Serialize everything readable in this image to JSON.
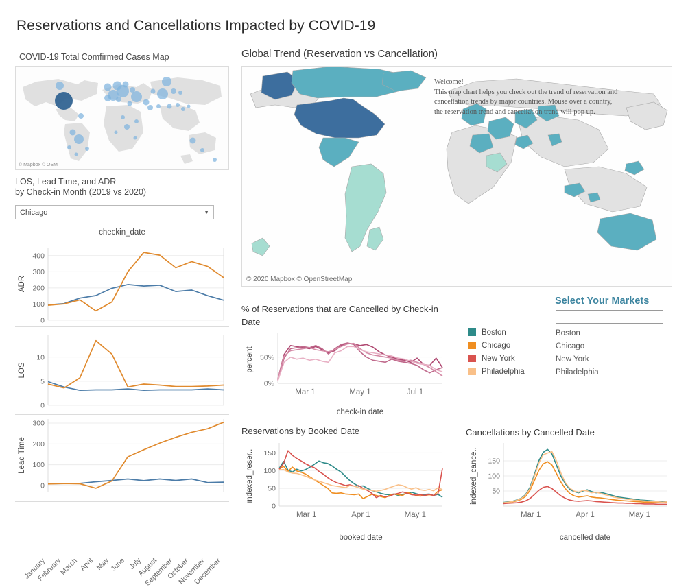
{
  "dashboard": {
    "title": "Reservations and Cancellations Impacted by COVID-19"
  },
  "covid_map": {
    "title": "COVID-19 Total Comfirmed Cases Map",
    "attribution": "© Mapbox © OSM"
  },
  "los_panel": {
    "title_line1": "LOS, Lead Time, and ADR",
    "title_line2": "by Check-in Month (2019 vs 2020)",
    "selected_market": "Chicago",
    "caret_icon": "▼",
    "column_label": "checkin_date"
  },
  "global_map": {
    "title": "Global Trend (Reservation vs Cancellation)",
    "attribution": "© 2020 Mapbox  © OpenStreetMap",
    "welcome": {
      "heading": "Welcome!",
      "body": "This map chart helps you check out the trend of reservation and cancellation trends by major countries. Mouse over a country, the reservation trend and cancellation trend will pop up."
    },
    "colors": {
      "high": "#3d6e9e",
      "mid": "#5bafc0",
      "low": "#a6ddd1",
      "none": "#e2e2e2",
      "border": "#a0a0a0"
    }
  },
  "legend": {
    "items": [
      {
        "label": "Boston",
        "color": "#2e8b89"
      },
      {
        "label": "Chicago",
        "color": "#ef8e21"
      },
      {
        "label": "New York",
        "color": "#d9534f"
      },
      {
        "label": "Philadelphia",
        "color": "#f9c089"
      }
    ]
  },
  "markets_filter": {
    "title": "Select Your Markets",
    "search_value": "",
    "search_placeholder": "",
    "options": [
      "Boston",
      "Chicago",
      "New York",
      "Philadelphia"
    ]
  },
  "chart_data": [
    {
      "type": "line",
      "name": "adr-by-checkin-month",
      "title": "checkin_date",
      "ylabel": "ADR",
      "xlabel": "",
      "ylim": [
        0,
        450
      ],
      "yticks": [
        0,
        100,
        200,
        300,
        400
      ],
      "grid": true,
      "categories": [
        "January",
        "February",
        "March",
        "April",
        "May",
        "June",
        "July",
        "August",
        "September",
        "October",
        "November",
        "December"
      ],
      "series": [
        {
          "name": "2019",
          "color": "#4c7ca8",
          "values": [
            95,
            103,
            137,
            153,
            198,
            221,
            212,
            217,
            178,
            187,
            152,
            124
          ]
        },
        {
          "name": "2020",
          "color": "#e08a2e",
          "values": [
            93,
            101,
            126,
            58,
            113,
            300,
            420,
            403,
            325,
            363,
            333,
            264
          ]
        }
      ]
    },
    {
      "type": "line",
      "name": "los-by-checkin-month",
      "title": "",
      "ylabel": "LOS",
      "xlabel": "",
      "ylim": [
        0,
        14.5
      ],
      "yticks": [
        0,
        5,
        10
      ],
      "grid": true,
      "categories": [
        "January",
        "February",
        "March",
        "April",
        "May",
        "June",
        "July",
        "August",
        "September",
        "October",
        "November",
        "December"
      ],
      "series": [
        {
          "name": "2019",
          "color": "#4c7ca8",
          "values": [
            4.9,
            3.8,
            3.1,
            3.2,
            3.2,
            3.4,
            3.1,
            3.2,
            3.2,
            3.2,
            3.4,
            3.2
          ]
        },
        {
          "name": "2020",
          "color": "#e08a2e",
          "values": [
            4.4,
            3.6,
            5.7,
            13.4,
            10.6,
            3.8,
            4.4,
            4.2,
            3.9,
            3.9,
            4.0,
            4.2
          ]
        }
      ]
    },
    {
      "type": "line",
      "name": "lead-time-by-checkin-month",
      "title": "",
      "ylabel": "Lead Time",
      "xlabel": "",
      "ylim": [
        -30,
        320
      ],
      "yticks": [
        0,
        100,
        200,
        300
      ],
      "grid": true,
      "categories": [
        "January",
        "February",
        "March",
        "April",
        "May",
        "June",
        "July",
        "August",
        "September",
        "October",
        "November",
        "December"
      ],
      "series": [
        {
          "name": "2019",
          "color": "#4c7ca8",
          "values": [
            8,
            9,
            10,
            18,
            24,
            31,
            23,
            31,
            24,
            31,
            14,
            16
          ]
        },
        {
          "name": "2020",
          "color": "#e08a2e",
          "values": [
            7,
            9,
            8,
            -13,
            22,
            138,
            172,
            204,
            232,
            256,
            273,
            304
          ]
        }
      ]
    },
    {
      "type": "line",
      "name": "pct-reservations-cancelled",
      "title": "% of Reservations that are Cancelled by Check-in Date",
      "ylabel": "percent",
      "xlabel": "check-in date",
      "ylim": [
        0,
        90
      ],
      "yticks": [
        0,
        50
      ],
      "ytick_labels": [
        "0%",
        "50%"
      ],
      "xticks": [
        "Mar 1",
        "May 1",
        "Jul 1"
      ],
      "grid": true,
      "series": [
        {
          "name": "Boston",
          "color": "#b04a72",
          "values": [
            8,
            55,
            72,
            70,
            68,
            66,
            70,
            64,
            58,
            62,
            72,
            76,
            75,
            72,
            74,
            69,
            60,
            54,
            50,
            46,
            44,
            40,
            48,
            36,
            34,
            48,
            30
          ]
        },
        {
          "name": "Chicago",
          "color": "#c06a8c",
          "values": [
            6,
            48,
            66,
            68,
            70,
            68,
            72,
            66,
            56,
            66,
            74,
            77,
            74,
            60,
            50,
            44,
            42,
            40,
            46,
            42,
            40,
            38,
            34,
            26,
            20,
            26,
            30
          ]
        },
        {
          "name": "New York",
          "color": "#d48aa6",
          "values": [
            7,
            52,
            62,
            64,
            66,
            68,
            64,
            62,
            60,
            64,
            70,
            75,
            76,
            66,
            58,
            54,
            52,
            50,
            48,
            44,
            42,
            44,
            40,
            36,
            30,
            22,
            14
          ]
        },
        {
          "name": "Philadelphia",
          "color": "#e8b0c4",
          "values": [
            5,
            40,
            50,
            46,
            48,
            44,
            46,
            42,
            40,
            58,
            62,
            70,
            70,
            64,
            60,
            58,
            56,
            54,
            52,
            48,
            46,
            42,
            38,
            36,
            34,
            26,
            22
          ]
        }
      ]
    },
    {
      "type": "line",
      "name": "reservations-by-booked-date",
      "title": "Reservations by Booked Date",
      "ylabel": "indexed_reser..",
      "xlabel": "booked date",
      "ylim": [
        0,
        170
      ],
      "yticks": [
        0,
        50,
        100,
        150
      ],
      "xticks": [
        "Mar 1",
        "Apr 1",
        "May 1"
      ],
      "grid": true,
      "series": [
        {
          "name": "Boston",
          "color": "#2e8b89",
          "values": [
            106,
            126,
            101,
            96,
            104,
            99,
            103,
            110,
            118,
            127,
            122,
            120,
            113,
            104,
            96,
            84,
            72,
            63,
            56,
            57,
            50,
            44,
            40,
            36,
            33,
            32,
            34,
            30,
            33,
            36,
            39,
            35,
            32,
            33,
            34,
            30,
            33,
            25
          ]
        },
        {
          "name": "Chicago",
          "color": "#ef8e21",
          "values": [
            104,
            112,
            98,
            110,
            99,
            95,
            90,
            82,
            74,
            66,
            58,
            50,
            37,
            36,
            37,
            34,
            33,
            32,
            34,
            21,
            27,
            33,
            30,
            27,
            24,
            30,
            34,
            32,
            30,
            39,
            34,
            30,
            28,
            30,
            32,
            30,
            42,
            46
          ]
        },
        {
          "name": "New York",
          "color": "#d9534f",
          "values": [
            104,
            120,
            156,
            143,
            134,
            127,
            119,
            113,
            108,
            98,
            90,
            80,
            72,
            66,
            62,
            58,
            60,
            56,
            58,
            50,
            44,
            36,
            24,
            30,
            26,
            28,
            33,
            36,
            40,
            36,
            32,
            31,
            32,
            30,
            33,
            30,
            35,
            106
          ]
        },
        {
          "name": "Philadelphia",
          "color": "#f9c089",
          "values": [
            102,
            103,
            96,
            93,
            92,
            88,
            84,
            79,
            74,
            70,
            66,
            62,
            58,
            56,
            54,
            52,
            58,
            56,
            52,
            48,
            46,
            44,
            42,
            44,
            47,
            52,
            56,
            60,
            58,
            52,
            48,
            52,
            46,
            44,
            47,
            43,
            52,
            46
          ]
        }
      ]
    },
    {
      "type": "line",
      "name": "cancellations-by-cancelled-date",
      "title": "Cancellations by Cancelled Date",
      "ylabel": "indexed_cance..",
      "xlabel": "cancelled date",
      "ylim": [
        0,
        200
      ],
      "yticks": [
        50,
        100,
        150
      ],
      "xticks": [
        "Mar 1",
        "Apr 1",
        "May 1"
      ],
      "grid": true,
      "series": [
        {
          "name": "Boston",
          "color": "#2e8b89",
          "values": [
            12,
            14,
            16,
            20,
            26,
            38,
            62,
            104,
            150,
            178,
            188,
            172,
            136,
            100,
            74,
            56,
            48,
            44,
            50,
            54,
            48,
            44,
            46,
            42,
            38,
            34,
            30,
            28,
            26,
            24,
            22,
            20,
            19,
            18,
            17,
            16,
            15,
            16
          ]
        },
        {
          "name": "Chicago",
          "color": "#ef8e21",
          "values": [
            10,
            12,
            14,
            17,
            22,
            32,
            52,
            84,
            118,
            140,
            147,
            136,
            108,
            80,
            58,
            42,
            34,
            30,
            32,
            34,
            30,
            28,
            27,
            25,
            23,
            21,
            19,
            18,
            17,
            16,
            15,
            14,
            13,
            13,
            12,
            12,
            11,
            12
          ]
        },
        {
          "name": "New York",
          "color": "#d9534f",
          "values": [
            8,
            9,
            10,
            11,
            13,
            17,
            25,
            38,
            52,
            62,
            65,
            58,
            46,
            34,
            26,
            20,
            17,
            16,
            17,
            18,
            17,
            15,
            14,
            13,
            12,
            11,
            10,
            10,
            9,
            9,
            8,
            8,
            7,
            7,
            7,
            6,
            6,
            6
          ]
        },
        {
          "name": "Philadelphia",
          "color": "#f9c089",
          "values": [
            11,
            13,
            15,
            19,
            25,
            36,
            58,
            98,
            142,
            170,
            176,
            180,
            150,
            110,
            78,
            60,
            50,
            46,
            52,
            50,
            44,
            46,
            42,
            38,
            34,
            30,
            27,
            25,
            23,
            21,
            19,
            18,
            17,
            16,
            15,
            14,
            13,
            14
          ]
        }
      ]
    }
  ]
}
